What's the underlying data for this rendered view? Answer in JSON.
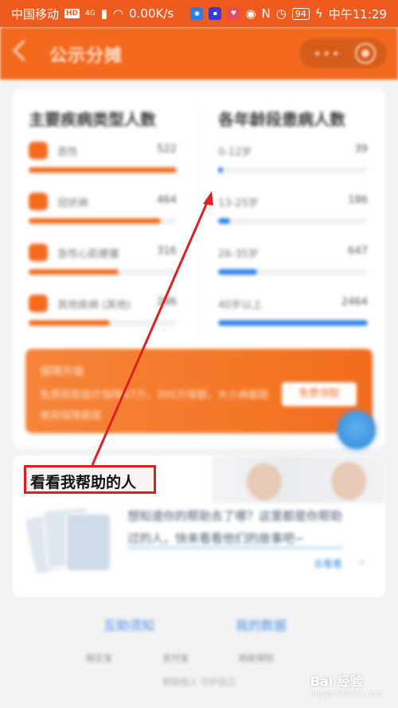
{
  "status_bar": {
    "carrier": "中国移动",
    "hd": "HD",
    "network": "4G",
    "speed": "0.00K/s",
    "battery": "94",
    "time": "中午11:29"
  },
  "header": {
    "title": "公示分摊",
    "more": "•••"
  },
  "stats": {
    "left_title": "主要疾病类型人数",
    "right_title": "各年龄段患病人数",
    "left_rows": [
      {
        "label": "恶性",
        "value": "522",
        "fill": 1.0
      },
      {
        "label": "冠状病",
        "value": "464",
        "fill": 0.89
      },
      {
        "label": "急性心肌梗塞",
        "value": "316",
        "fill": 0.61
      },
      {
        "label": "其他疾病 (其他)",
        "value": "286",
        "fill": 0.55
      }
    ],
    "right_rows": [
      {
        "label": "0-12岁",
        "value": "39",
        "fill": 0.02
      },
      {
        "label": "13-25岁",
        "value": "186",
        "fill": 0.08
      },
      {
        "label": "26-35岁",
        "value": "647",
        "fill": 0.26
      },
      {
        "label": "40岁以上",
        "value": "2464",
        "fill": 1.0
      }
    ]
  },
  "banner": {
    "title": "保障升级",
    "text": "免费获取医疗保障47万，300万保额，大小病都能使用保障额度",
    "button": "免费领取"
  },
  "help_section": {
    "title": "看看我帮助的人",
    "quote": "想知道你的帮助去了哪？这里都是你帮助过的人，快来看看他们的故事吧~",
    "more": "去看看"
  },
  "bottom": {
    "links": [
      "互助须知",
      "我的数据"
    ],
    "partners": [
      "相互宝",
      "支付宝",
      "蚂蚁保险"
    ],
    "footer": "帮助他人 守护自己"
  },
  "watermark": {
    "brand": "Bai 经验",
    "url": "jingyan.baidu.com"
  }
}
